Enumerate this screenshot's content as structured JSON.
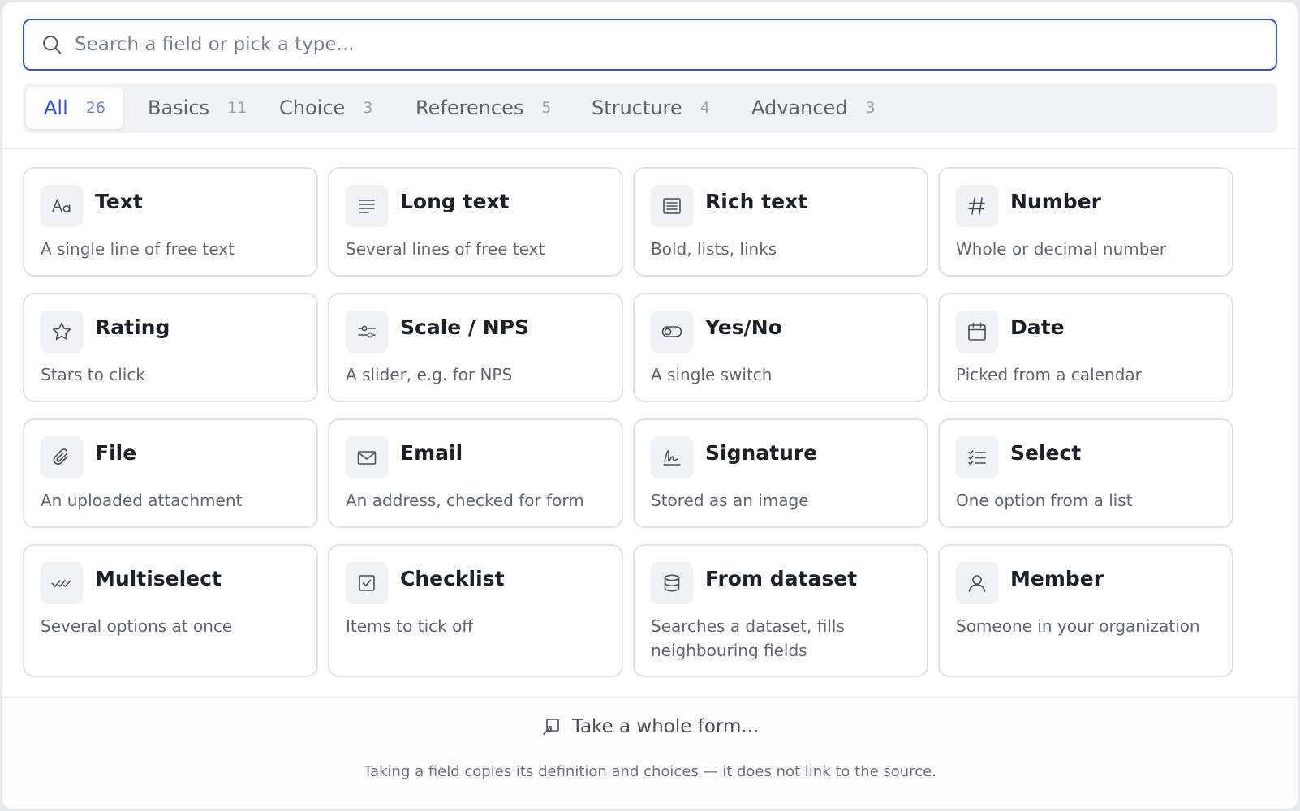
{
  "search": {
    "placeholder": "Search a field or pick a type...",
    "value": ""
  },
  "tabs": [
    {
      "label": "All",
      "count": "26",
      "active": true
    },
    {
      "label": "Basics",
      "count": "11"
    },
    {
      "label": "Choice",
      "count": "3"
    },
    {
      "label": "References",
      "count": "5"
    },
    {
      "label": "Structure",
      "count": "4"
    },
    {
      "label": "Advanced",
      "count": "3"
    }
  ],
  "cards": [
    {
      "title": "Text",
      "desc": "A single line of free text",
      "icon": "text-aa-icon"
    },
    {
      "title": "Long text",
      "desc": "Several lines of free text",
      "icon": "paragraph-lines-icon"
    },
    {
      "title": "Rich text",
      "desc": "Bold, lists, links",
      "icon": "document-lines-icon"
    },
    {
      "title": "Number",
      "desc": "Whole or decimal number",
      "icon": "hash-icon"
    },
    {
      "title": "Rating",
      "desc": "Stars to click",
      "icon": "star-icon"
    },
    {
      "title": "Scale / NPS",
      "desc": "A slider, e.g. for NPS",
      "icon": "sliders-icon"
    },
    {
      "title": "Yes/No",
      "desc": "A single switch",
      "icon": "toggle-icon"
    },
    {
      "title": "Date",
      "desc": "Picked from a calendar",
      "icon": "calendar-icon"
    },
    {
      "title": "File",
      "desc": "An uploaded attachment",
      "icon": "paperclip-icon"
    },
    {
      "title": "Email",
      "desc": "An address, checked for form",
      "icon": "envelope-icon"
    },
    {
      "title": "Signature",
      "desc": "Stored as an image",
      "icon": "signature-icon"
    },
    {
      "title": "Select",
      "desc": "One option from a list",
      "icon": "checklist-icon"
    },
    {
      "title": "Multiselect",
      "desc": "Several options at once",
      "icon": "double-check-icon"
    },
    {
      "title": "Checklist",
      "desc": "Items to tick off",
      "icon": "checkbox-icon"
    },
    {
      "title": "From dataset",
      "desc": "Searches a dataset, fills neighbouring fields",
      "icon": "database-icon"
    },
    {
      "title": "Member",
      "desc": "Someone in your organization",
      "icon": "user-icon"
    }
  ],
  "footer": {
    "take_form_label": "Take a whole form...",
    "take_form_icon": "form-import-icon",
    "note": "Taking a field copies its definition and choices — it does not link to the source."
  }
}
